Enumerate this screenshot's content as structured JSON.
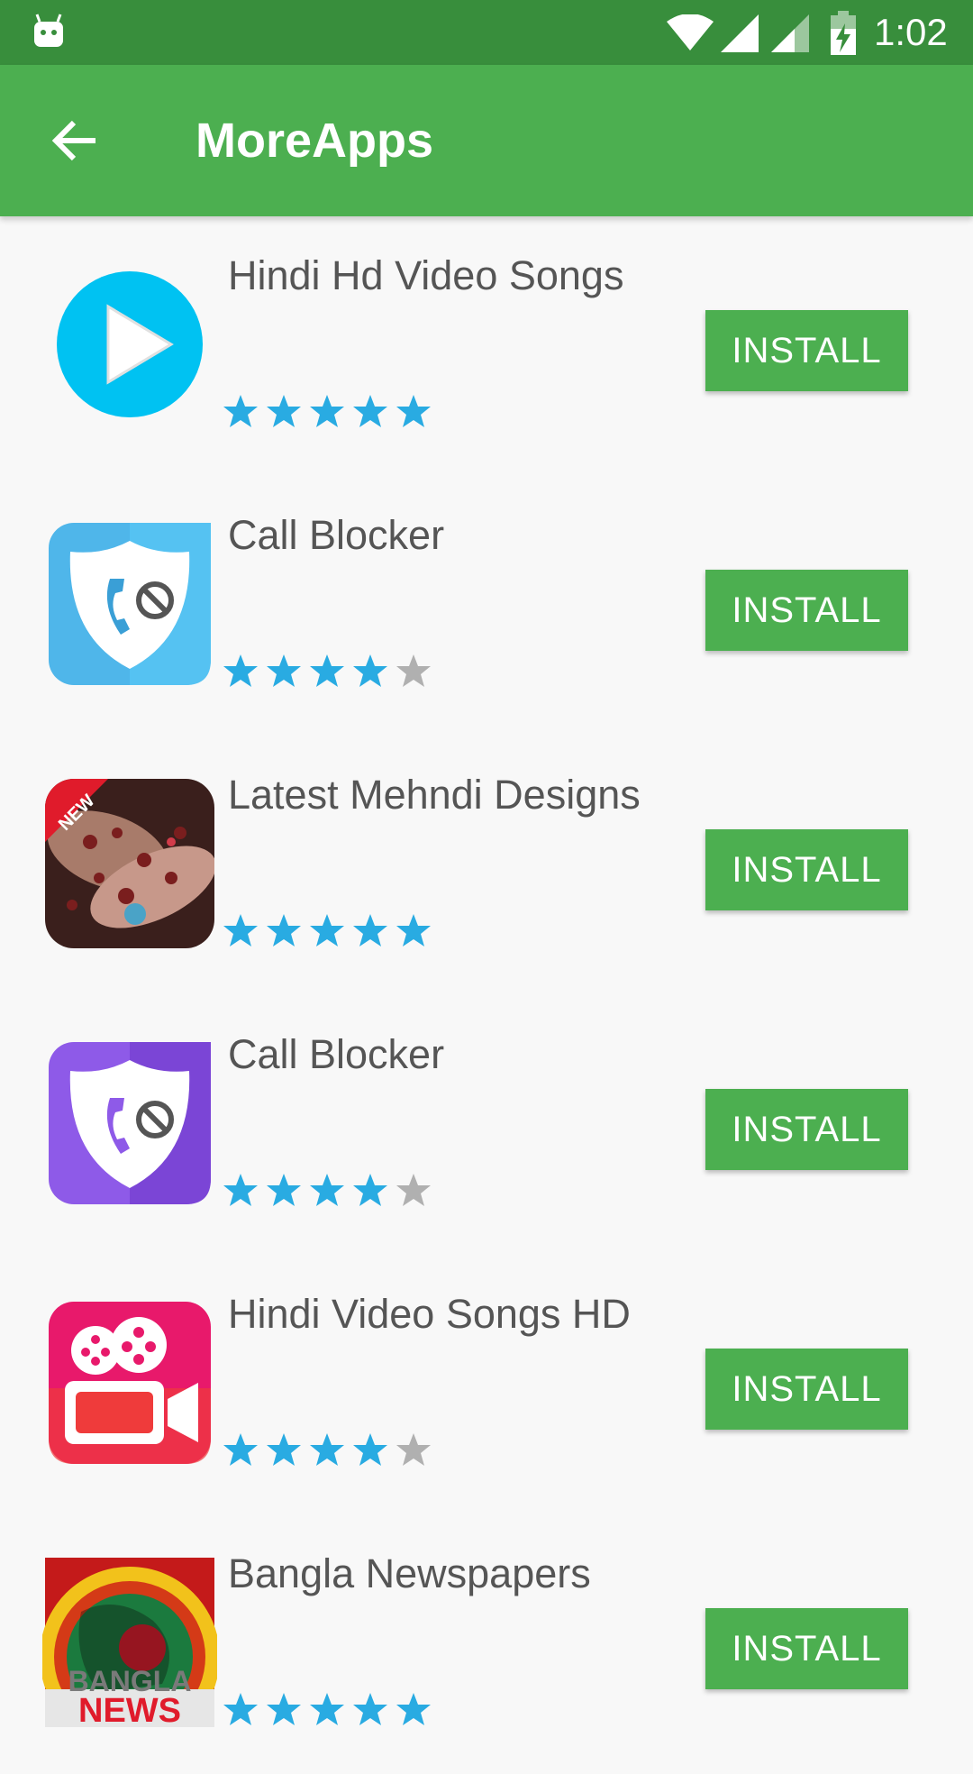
{
  "status_bar": {
    "time": "1:02"
  },
  "app_bar": {
    "title": "MoreApps",
    "back_icon": "arrow-back-icon"
  },
  "apps": [
    {
      "name": "Hindi Hd Video Songs",
      "rating": 5,
      "button": "INSTALL",
      "icon": "play-icon"
    },
    {
      "name": "Call Blocker",
      "rating": 4,
      "button": "INSTALL",
      "icon": "call-blocker-blue-icon"
    },
    {
      "name": "Latest Mehndi Designs",
      "rating": 5,
      "button": "INSTALL",
      "icon": "mehndi-icon"
    },
    {
      "name": "Call Blocker",
      "rating": 4,
      "button": "INSTALL",
      "icon": "call-blocker-purple-icon"
    },
    {
      "name": "Hindi Video Songs HD",
      "rating": 4,
      "button": "INSTALL",
      "icon": "movie-camera-icon"
    },
    {
      "name": "Bangla Newspapers",
      "rating": 5,
      "button": "INSTALL",
      "icon": "bangla-news-icon",
      "icon_text": [
        "BANGLA",
        "NEWS"
      ]
    }
  ],
  "colors": {
    "primary": "#4caf50",
    "primary_dark": "#388e3c",
    "star_on": "#29abe2",
    "star_off": "#b0b0b0"
  }
}
